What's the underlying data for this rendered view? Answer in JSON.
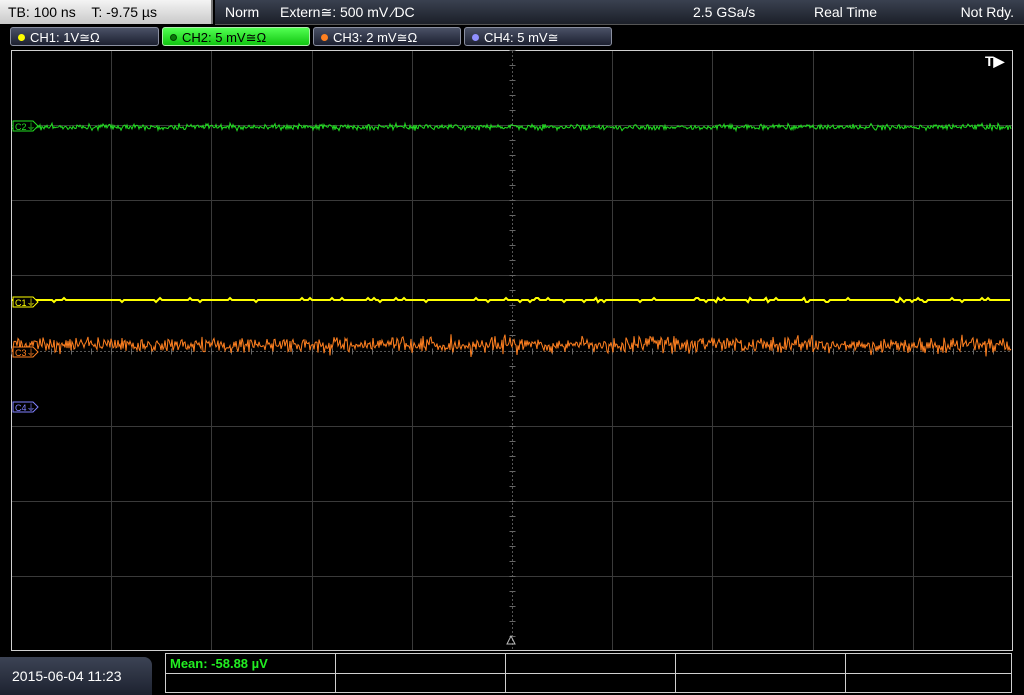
{
  "timebase": {
    "tb": "TB: 100 ns",
    "trigger_time": "T: -9.75 µs"
  },
  "status_bar": {
    "trigger_mode": "Norm",
    "trigger_source": "Extern≅: 500 mV ⁄DC",
    "sample_rate": "2.5 GSa/s",
    "acquisition_mode": "Real Time",
    "status": "Not Rdy."
  },
  "channels": [
    {
      "label": "CH1: 1V≅Ω",
      "marker": "C1",
      "color": "#ffff00"
    },
    {
      "label": "CH2: 5 mV≅Ω",
      "marker": "C2",
      "color": "#22e022"
    },
    {
      "label": "CH3: 2 mV≅Ω",
      "marker": "C3",
      "color": "#ff8020"
    },
    {
      "label": "CH4: 5 mV≅",
      "marker": "C4",
      "color": "#8080ff"
    }
  ],
  "trigger_marker": "T▶",
  "datetime": "2015-06-04 11:23",
  "measurement": {
    "mean": "Mean: -58.88 µV"
  }
}
